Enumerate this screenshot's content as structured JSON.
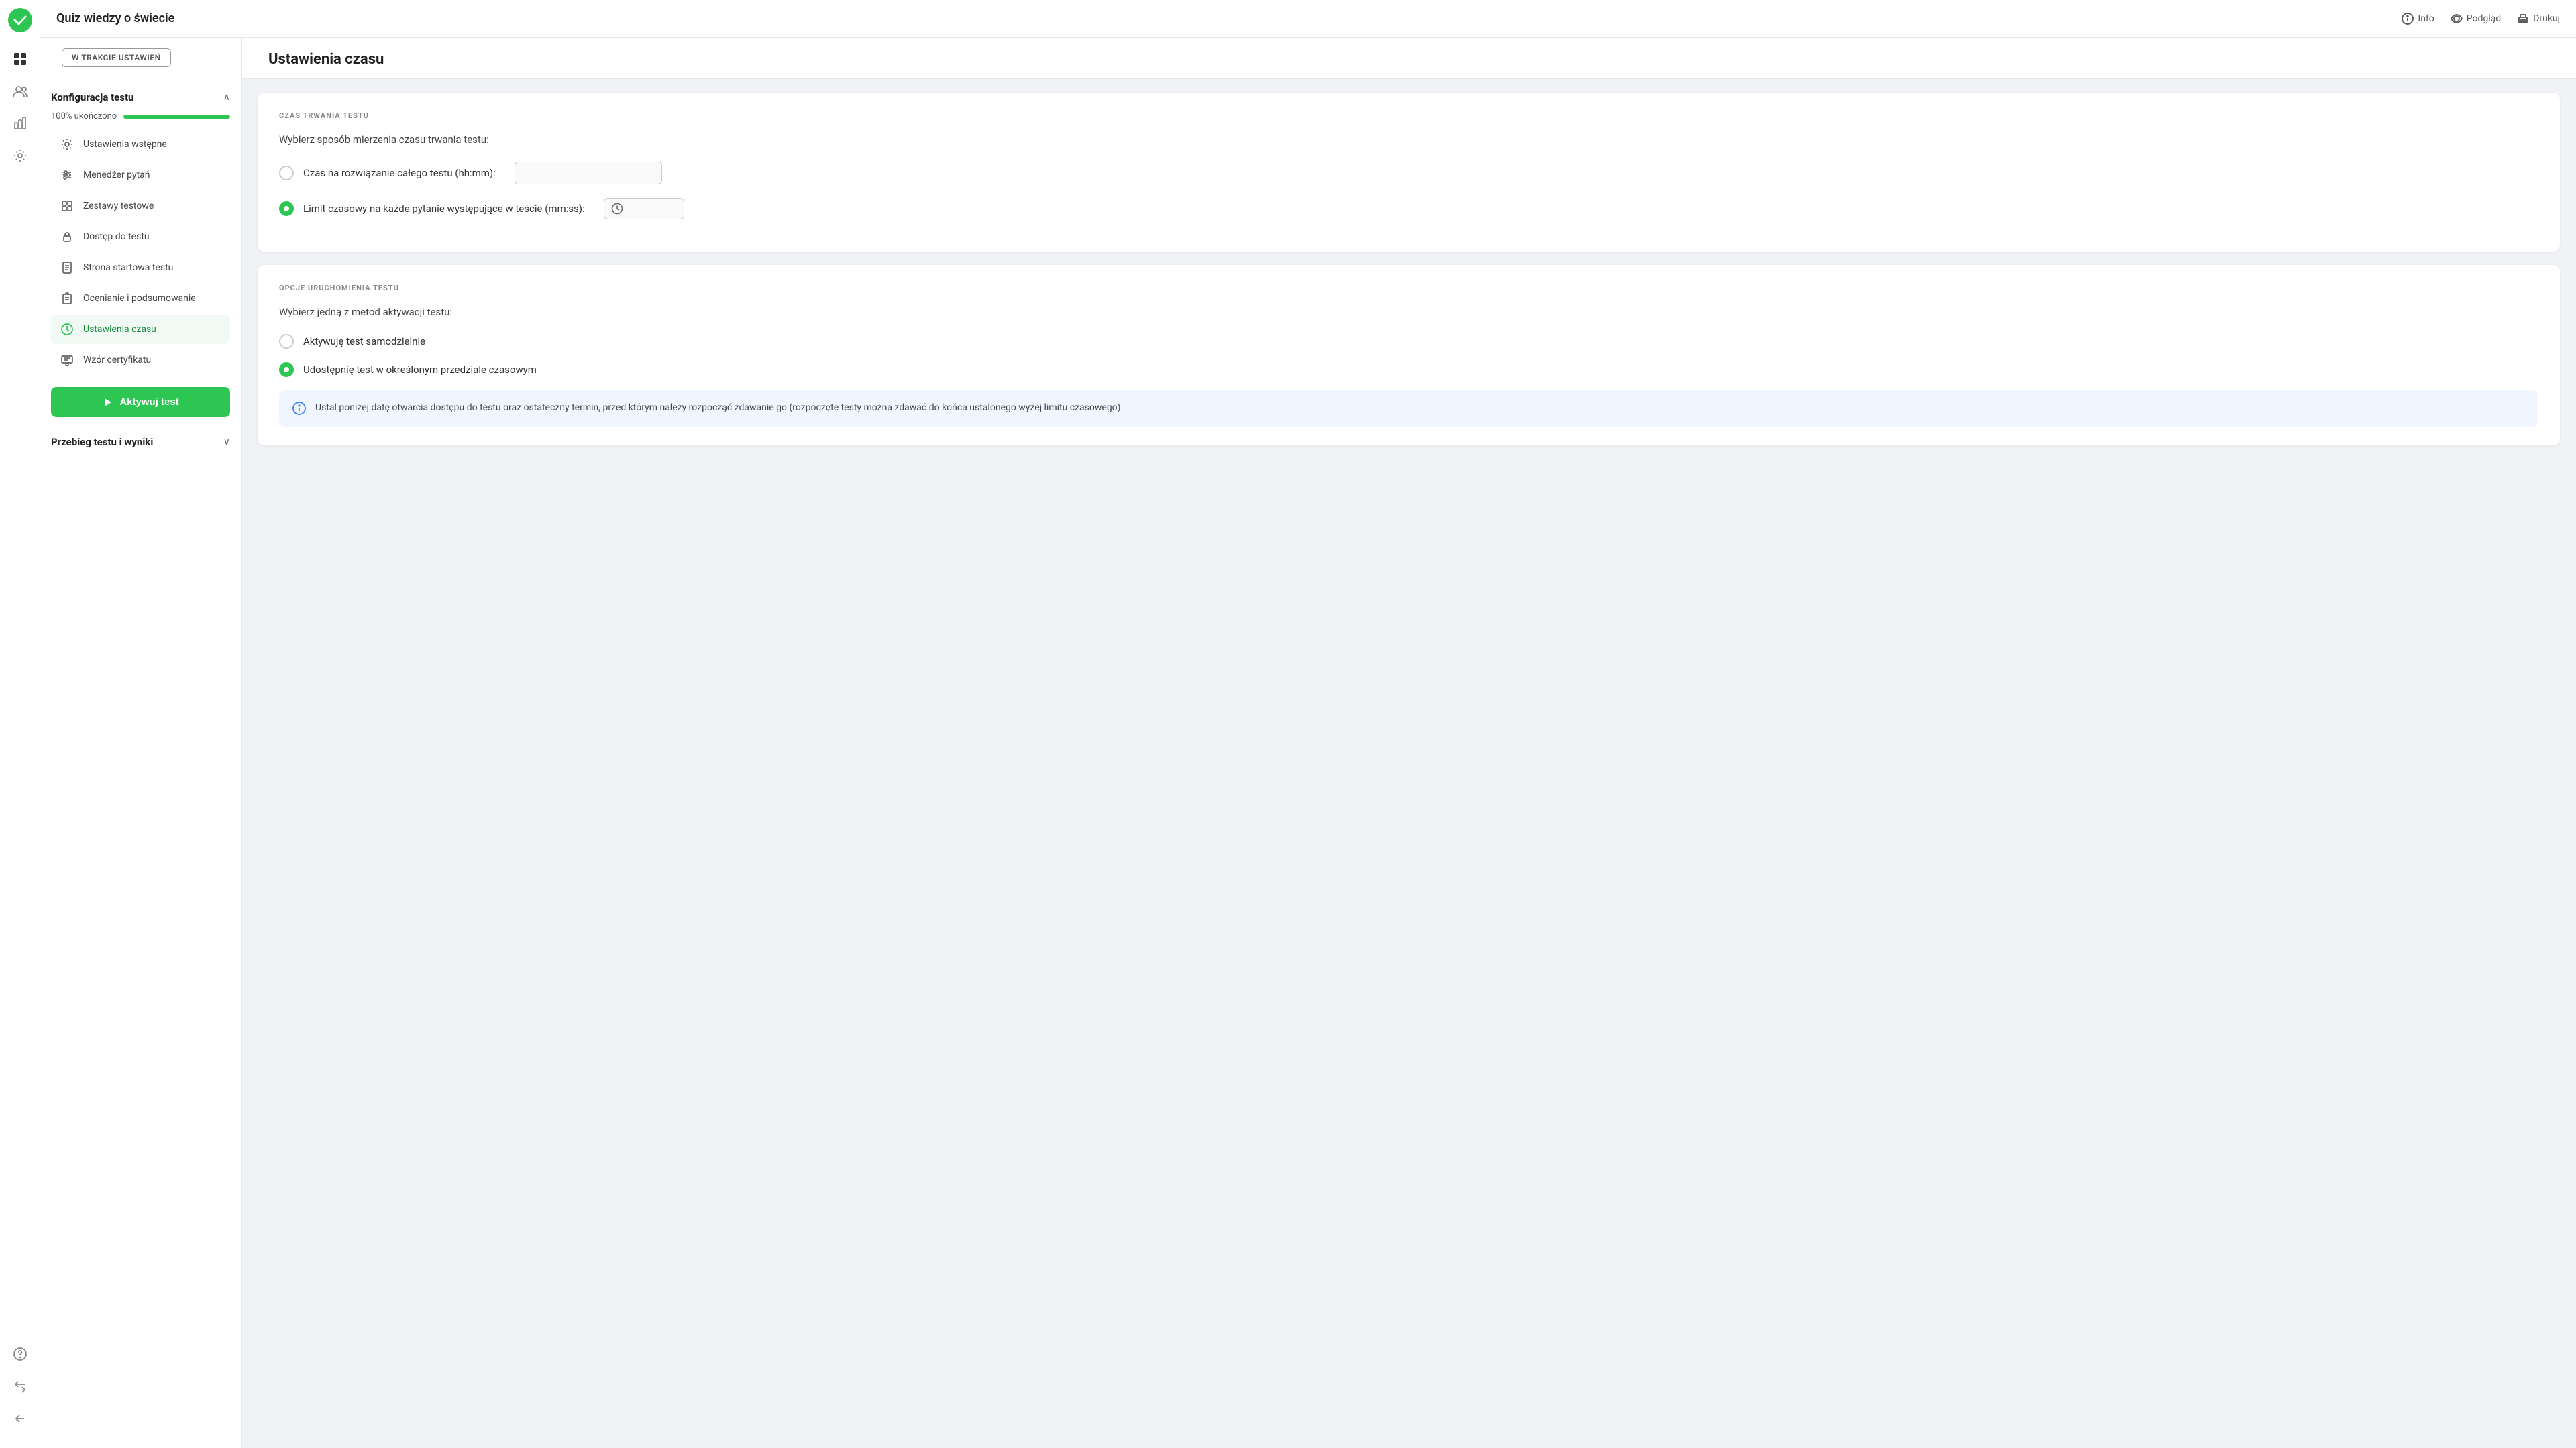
{
  "app": {
    "title": "Quiz wiedzy o świecie"
  },
  "header": {
    "title": "Quiz wiedzy o świecie",
    "actions": [
      {
        "id": "info",
        "label": "Info"
      },
      {
        "id": "preview",
        "label": "Podgląd"
      },
      {
        "id": "print",
        "label": "Drukuj"
      }
    ]
  },
  "sidebar": {
    "status_badge": "W TRAKCIE USTAWIEŃ",
    "section1": {
      "title": "Konfiguracja testu",
      "progress_label": "100% ukończono",
      "progress_value": 100,
      "nav_items": [
        {
          "id": "ustawienia-wstepne",
          "label": "Ustawienia wstępne",
          "icon": "gear",
          "active": false
        },
        {
          "id": "menedzer-pytan",
          "label": "Menedżer pytań",
          "icon": "sliders",
          "active": false
        },
        {
          "id": "zestawy-testowe",
          "label": "Zestawy testowe",
          "icon": "grid",
          "active": false
        },
        {
          "id": "dostep-do-testu",
          "label": "Dostęp do testu",
          "icon": "lock",
          "active": false
        },
        {
          "id": "strona-startowa",
          "label": "Strona startowa testu",
          "icon": "file",
          "active": false
        },
        {
          "id": "ocenianie",
          "label": "Ocenianie i podsumowanie",
          "icon": "clipboard",
          "active": false
        },
        {
          "id": "ustawienia-czasu",
          "label": "Ustawienia czasu",
          "icon": "clock",
          "active": true
        },
        {
          "id": "wzor-certyfikatu",
          "label": "Wzór certyfikatu",
          "icon": "certificate",
          "active": false
        }
      ]
    },
    "activate_button": "Aktywuj test",
    "section2": {
      "title": "Przebieg testu i wyniki"
    }
  },
  "main": {
    "page_title": "Ustawienia czasu",
    "section1": {
      "label": "CZAS TRWANIA TESTU",
      "description": "Wybierz sposób mierzenia czasu trwania testu:",
      "options": [
        {
          "id": "czas-calego-testu",
          "label": "Czas na rozwiązanie całego testu (hh:mm):",
          "checked": false,
          "has_input": true
        },
        {
          "id": "limit-czasowy",
          "label": "Limit czasowy na każde pytanie występujące w teście (mm:ss):",
          "checked": true,
          "has_input": true
        }
      ]
    },
    "section2": {
      "label": "OPCJE URUCHOMIENIA TESTU",
      "description": "Wybierz jedną z metod aktywacji testu:",
      "options": [
        {
          "id": "samodzielnie",
          "label": "Aktywuję test samodzielnie",
          "checked": false
        },
        {
          "id": "przedzial-czasowy",
          "label": "Udostępnię test w określonym przedziale czasowym",
          "checked": true
        }
      ],
      "info_text": "Ustal poniżej datę otwarcia dostępu do testu oraz ostateczny termin, przed którym należy rozpocząć zdawanie go (rozpoczęte testy można zdawać do końca ustalonego wyżej limitu czasowego)."
    }
  }
}
